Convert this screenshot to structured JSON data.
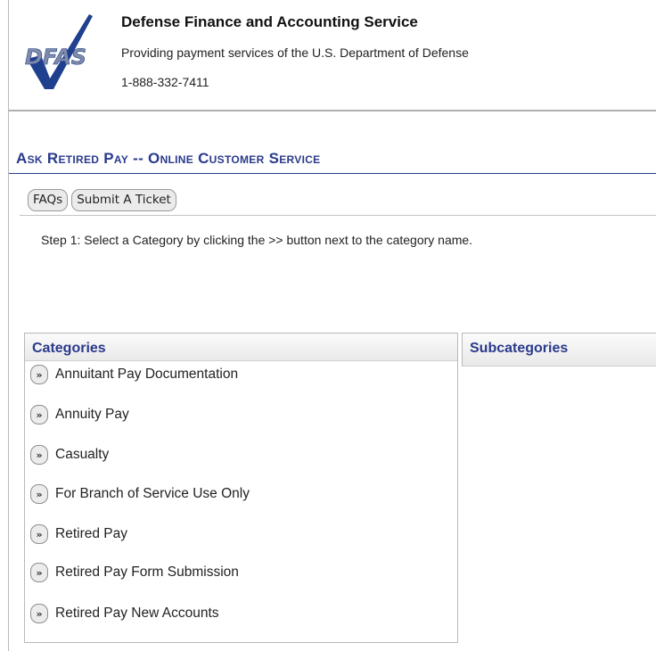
{
  "header": {
    "logo_text": "DFAS",
    "org_name": "Defense Finance and Accounting Service",
    "tagline": "Providing payment services of the U.S. Department of Defense",
    "phone": "1-888-332-7411"
  },
  "page": {
    "title": "Ask Retired Pay -- Online Customer Service",
    "step_text": "Step 1: Select a Category by clicking the >> button next to the category name."
  },
  "tabs": [
    {
      "label": "FAQs"
    },
    {
      "label": "Submit A Ticket"
    }
  ],
  "categories_panel": {
    "header": "Categories",
    "button_glyph": "»",
    "items": [
      {
        "label": "Annuitant Pay Documentation"
      },
      {
        "label": "Annuity Pay"
      },
      {
        "label": "Casualty"
      },
      {
        "label": "For Branch of Service Use Only"
      },
      {
        "label": "Retired Pay"
      },
      {
        "label": "Retired Pay Form Submission"
      },
      {
        "label": "Retired Pay New Accounts"
      }
    ]
  },
  "subcategories_panel": {
    "header": "Subcategories"
  },
  "colors": {
    "accent": "#2a3a8c",
    "logo_blue": "#1f3f8f"
  }
}
